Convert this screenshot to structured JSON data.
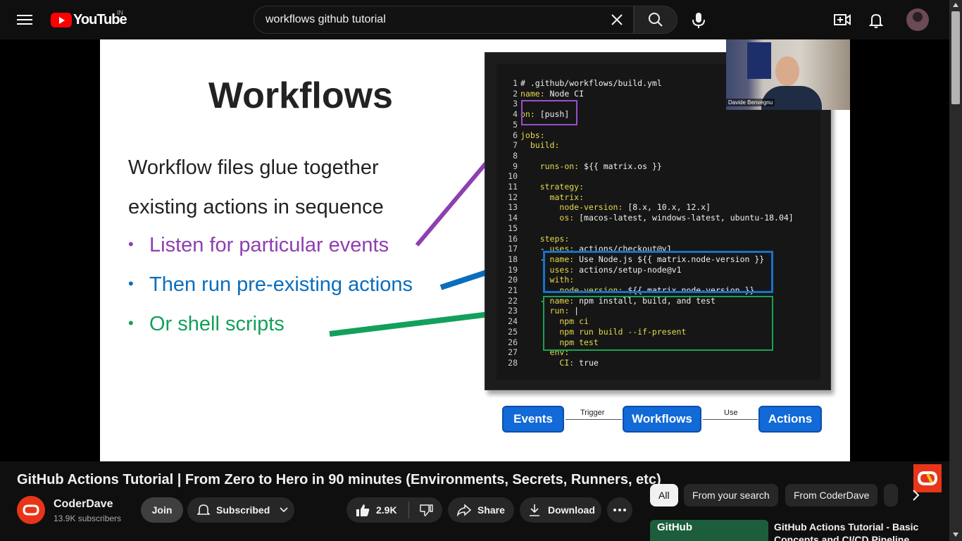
{
  "header": {
    "logo_text": "YouTube",
    "country_code": "IN",
    "search_value": "workflows github tutorial",
    "search_placeholder": "Search"
  },
  "slide": {
    "title": "Workflows",
    "line1": "Workflow files glue together",
    "line2": "existing actions in sequence",
    "bullets": [
      "Listen for particular events",
      "Then run pre-existing actions",
      "Or shell scripts"
    ],
    "code_lines": [
      {
        "n": "1",
        "text": "# .github/workflows/build.yml"
      },
      {
        "n": "2",
        "text": "name: Node CI"
      },
      {
        "n": "3",
        "text": ""
      },
      {
        "n": "4",
        "text": "on: [push]"
      },
      {
        "n": "5",
        "text": ""
      },
      {
        "n": "6",
        "text": "jobs:"
      },
      {
        "n": "7",
        "text": "  build:"
      },
      {
        "n": "8",
        "text": ""
      },
      {
        "n": "9",
        "text": "    runs-on: ${{ matrix.os }}"
      },
      {
        "n": "10",
        "text": ""
      },
      {
        "n": "11",
        "text": "    strategy:"
      },
      {
        "n": "12",
        "text": "      matrix:"
      },
      {
        "n": "13",
        "text": "        node-version: [8.x, 10.x, 12.x]"
      },
      {
        "n": "14",
        "text": "        os: [macos-latest, windows-latest, ubuntu-18.04]"
      },
      {
        "n": "15",
        "text": ""
      },
      {
        "n": "16",
        "text": "    steps:"
      },
      {
        "n": "17",
        "text": "    - uses: actions/checkout@v1"
      },
      {
        "n": "18",
        "text": "    - name: Use Node.js ${{ matrix.node-version }}"
      },
      {
        "n": "19",
        "text": "      uses: actions/setup-node@v1"
      },
      {
        "n": "20",
        "text": "      with:"
      },
      {
        "n": "21",
        "text": "        node-version: ${{ matrix.node-version }}"
      },
      {
        "n": "22",
        "text": "    - name: npm install, build, and test"
      },
      {
        "n": "23",
        "text": "      run: |"
      },
      {
        "n": "24",
        "text": "        npm ci"
      },
      {
        "n": "25",
        "text": "        npm run build --if-present"
      },
      {
        "n": "26",
        "text": "        npm test"
      },
      {
        "n": "27",
        "text": "      env:"
      },
      {
        "n": "28",
        "text": "        CI: true"
      }
    ],
    "webcam_name": "Davide Benvegnu",
    "flow": {
      "events": "Events",
      "trigger": "Trigger",
      "workflows": "Workflows",
      "use": "Use",
      "actions": "Actions"
    }
  },
  "video": {
    "title": "GitHub Actions Tutorial | From Zero to Hero in 90 minutes (Environments, Secrets, Runners, etc)",
    "channel_name": "CoderDave",
    "subscribers": "13.9K subscribers",
    "join_label": "Join",
    "subscribed_label": "Subscribed",
    "like_count": "2.9K",
    "share_label": "Share",
    "download_label": "Download"
  },
  "sidebar": {
    "chips": [
      "All",
      "From your search",
      "From CoderDave"
    ],
    "rec_thumb_text": "GitHub",
    "rec_title": "GitHub Actions Tutorial - Basic Concepts and CI/CD Pipeline"
  },
  "colors": {
    "brand_red": "#ff0000",
    "purple_highlight": "#9b4ecb",
    "blue_highlight": "#1572cc",
    "green_highlight": "#17a34f",
    "flow_blue": "#1269d8"
  }
}
